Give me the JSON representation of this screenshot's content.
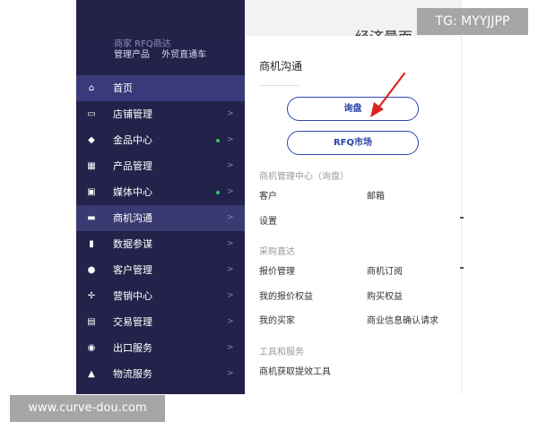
{
  "top": {
    "faint_text": "商家  RFQ商达",
    "links": [
      "管理产品",
      "外贸直通车"
    ],
    "cut_heading": "经济量面"
  },
  "sidebar": {
    "items": [
      {
        "label": "首页",
        "icon": "home-icon",
        "glyph": "⌂",
        "chevron": "",
        "dot": false
      },
      {
        "label": "店铺管理",
        "icon": "store-icon",
        "glyph": "▭",
        "chevron": ">",
        "dot": false
      },
      {
        "label": "金品中心",
        "icon": "shield-icon",
        "glyph": "◆",
        "chevron": ">",
        "dot": true
      },
      {
        "label": "产品管理",
        "icon": "grid-icon",
        "glyph": "▦",
        "chevron": ">",
        "dot": false
      },
      {
        "label": "媒体中心",
        "icon": "media-icon",
        "glyph": "▣",
        "chevron": ">",
        "dot": true
      },
      {
        "label": "商机沟通",
        "icon": "chat-icon",
        "glyph": "▬",
        "chevron": ">",
        "dot": false
      },
      {
        "label": "数据参谋",
        "icon": "chart-icon",
        "glyph": "▮",
        "chevron": ">",
        "dot": false
      },
      {
        "label": "客户管理",
        "icon": "users-icon",
        "glyph": "●",
        "chevron": ">",
        "dot": false
      },
      {
        "label": "营销中心",
        "icon": "marketing-icon",
        "glyph": "✢",
        "chevron": ">",
        "dot": false
      },
      {
        "label": "交易管理",
        "icon": "clipboard-icon",
        "glyph": "▤",
        "chevron": ">",
        "dot": false
      },
      {
        "label": "出口服务",
        "icon": "globe-icon",
        "glyph": "◉",
        "chevron": ">",
        "dot": false
      },
      {
        "label": "物流服务",
        "icon": "truck-icon",
        "glyph": "▲",
        "chevron": ">",
        "dot": false
      }
    ]
  },
  "panel": {
    "title": "商机沟通",
    "buttons": {
      "inquiry": "询盘",
      "rfq": "RFQ市场"
    },
    "section1": {
      "heading": "商机管理中心（询盘）",
      "links": [
        "客户",
        "邮箱",
        "设置"
      ]
    },
    "section2": {
      "heading": "采购直达",
      "links": [
        "报价管理",
        "商机订阅",
        "我的报价权益",
        "购买权益",
        "我的买家",
        "商业信息确认请求"
      ]
    },
    "section3": {
      "heading": "工具和服务",
      "links": [
        "商机获取提效工具"
      ]
    }
  },
  "watermarks": {
    "tg": "TG: MYYJJPP",
    "site": "www.curve-dou.com"
  },
  "colors": {
    "sidebar_bg": "#22224a",
    "active_bg": "#3a3a7a",
    "accent_blue": "#2e47ad",
    "arrow_red": "#d9251c",
    "dot_green": "#36c26a"
  }
}
